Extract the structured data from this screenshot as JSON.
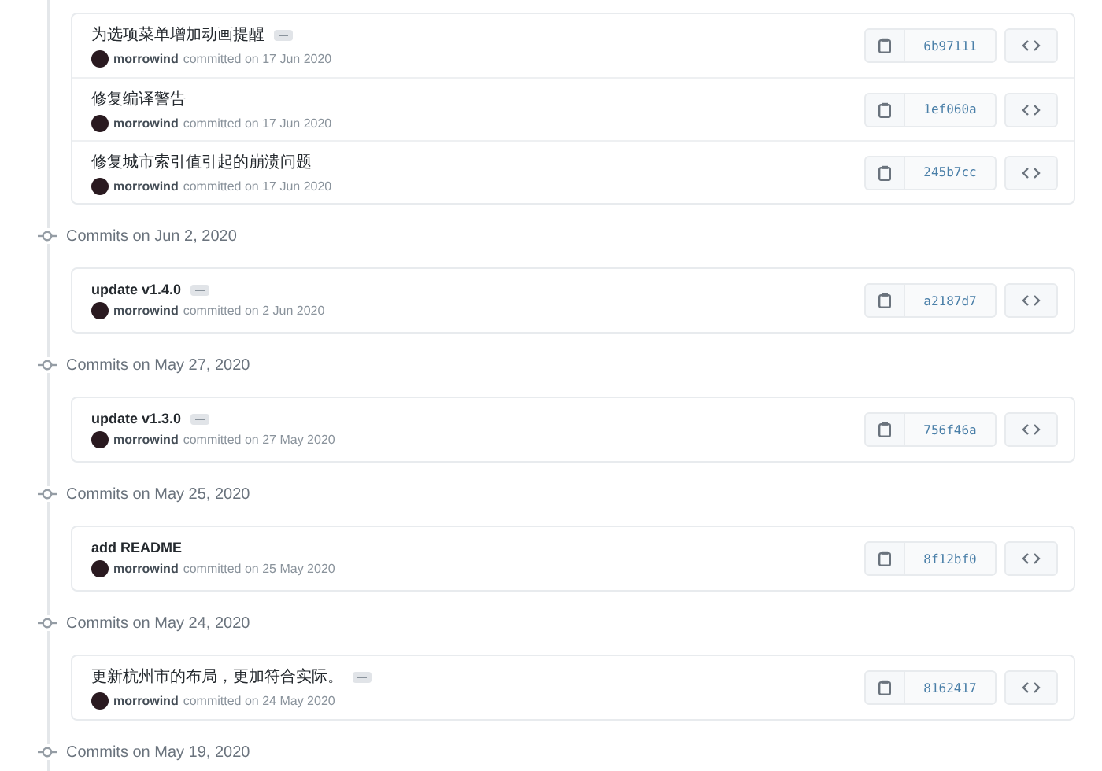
{
  "groups": [
    {
      "commits": [
        {
          "message": "为选项菜单增加动画提醒",
          "expandable": true,
          "author": "morrowind",
          "meta": "committed on 17 Jun 2020",
          "sha": "6b97111"
        },
        {
          "message": "修复编译警告",
          "expandable": false,
          "author": "morrowind",
          "meta": "committed on 17 Jun 2020",
          "sha": "1ef060a"
        },
        {
          "message": "修复城市索引值引起的崩溃问题",
          "expandable": false,
          "author": "morrowind",
          "meta": "committed on 17 Jun 2020",
          "sha": "245b7cc"
        }
      ]
    },
    {
      "header": "Commits on Jun 2, 2020",
      "commits": [
        {
          "message": "update v1.4.0",
          "expandable": true,
          "author": "morrowind",
          "meta": "committed on 2 Jun 2020",
          "sha": "a2187d7"
        }
      ]
    },
    {
      "header": "Commits on May 27, 2020",
      "commits": [
        {
          "message": "update v1.3.0",
          "expandable": true,
          "author": "morrowind",
          "meta": "committed on 27 May 2020",
          "sha": "756f46a"
        }
      ]
    },
    {
      "header": "Commits on May 25, 2020",
      "commits": [
        {
          "message": "add README",
          "expandable": false,
          "author": "morrowind",
          "meta": "committed on 25 May 2020",
          "sha": "8f12bf0"
        }
      ]
    },
    {
      "header": "Commits on May 24, 2020",
      "commits": [
        {
          "message": "更新杭州市的布局，更加符合实际。",
          "expandable": true,
          "author": "morrowind",
          "meta": "committed on 24 May 2020",
          "sha": "8162417"
        }
      ]
    },
    {
      "header": "Commits on May 19, 2020"
    }
  ]
}
